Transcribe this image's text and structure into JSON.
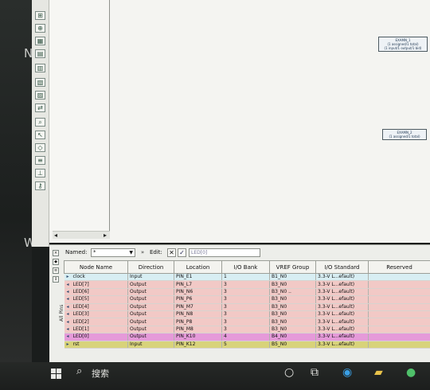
{
  "desktop": {
    "left_glyph": "N",
    "left_glyph_2": "W"
  },
  "toolbar_icons": [
    "pin-icon",
    "zoom-icon",
    "grid-icon",
    "table-icon",
    "bank-icon",
    "filter-icon",
    "layout-icon",
    "io-icon",
    "search-icon",
    "pointer-icon",
    "tag-icon",
    "ruler-icon",
    "probe-icon",
    "key-icon"
  ],
  "canvas": {
    "symbol_1": {
      "title": "EXAMN_1",
      "line1": "(1 assigned/1 total)",
      "line2": "(1 input/1 output/1 bid)"
    },
    "symbol_2": {
      "title": "EXAMN_2",
      "line1": "(1 assigned/1 total)"
    },
    "scroll_left": "◂",
    "scroll_right": "▸"
  },
  "panel": {
    "side_label": "All Pins",
    "named_label": "Named:",
    "named_value": "*",
    "expand_label": "»",
    "edit_label": "Edit:",
    "cancel_glyph": "✕",
    "accept_glyph": "✓",
    "edit_value": "LED[0]"
  },
  "table": {
    "headers": [
      "Node Name",
      "Direction",
      "Location",
      "I/O Bank",
      "VREF Group",
      "I/O Standard",
      "Reserved"
    ],
    "rows": [
      {
        "name": "clock",
        "direction": "Input",
        "location": "PIN_E1",
        "bank": "1",
        "vref": "B1_N0",
        "standard": "3.3-V L...efault)",
        "color": "#d8eef3"
      },
      {
        "name": "LED[7]",
        "direction": "Output",
        "location": "PIN_L7",
        "bank": "3",
        "vref": "B3_N0",
        "standard": "3.3-V L...efault)",
        "color": "#f2c9c6"
      },
      {
        "name": "LED[6]",
        "direction": "Output",
        "location": "PIN_N6",
        "bank": "3",
        "vref": "B3_N0 ..",
        "standard": "3.3-V L...efault)",
        "color": "#f2c9c6"
      },
      {
        "name": "LED[5]",
        "direction": "Output",
        "location": "PIN_P6",
        "bank": "3",
        "vref": "B3_N0",
        "standard": "3.3-V L...efault)",
        "color": "#f2c9c6"
      },
      {
        "name": "LED[4]",
        "direction": "Output",
        "location": "PIN_M7",
        "bank": "3",
        "vref": "B3_N0",
        "standard": "3.3-V L...efault)",
        "color": "#f2c9c6"
      },
      {
        "name": "LED[3]",
        "direction": "Output",
        "location": "PIN_N8",
        "bank": "3",
        "vref": "B3_N0",
        "standard": "3.3-V L...efault)",
        "color": "#f2c9c6"
      },
      {
        "name": "LED[2]",
        "direction": "Output",
        "location": "PIN_P8",
        "bank": "3",
        "vref": "B3_N0",
        "standard": "3.3-V L...efault)",
        "color": "#f2c9c6"
      },
      {
        "name": "LED[1]",
        "direction": "Output",
        "location": "PIN_M8",
        "bank": "3",
        "vref": "B3_N0",
        "standard": "3.3-V L...efault)",
        "color": "#f2c9c6"
      },
      {
        "name": "LED[0]",
        "direction": "Output",
        "location": "PIN_K10",
        "bank": "4",
        "vref": "B4_N0",
        "standard": "3.3-V L...efault)",
        "color": "#e59ad9"
      },
      {
        "name": "rst",
        "direction": "Input",
        "location": "PIN_K12",
        "bank": "5",
        "vref": "B5_N0",
        "standard": "3.3-V L...efault)",
        "color": "#d8d37a"
      }
    ]
  },
  "taskbar": {
    "search_label": "搜索",
    "icons": [
      "windows-start-icon",
      "search-icon",
      "task-view-icon",
      "snap-icon",
      "edge-browser-icon",
      "file-explorer-icon",
      "app-icon"
    ]
  }
}
